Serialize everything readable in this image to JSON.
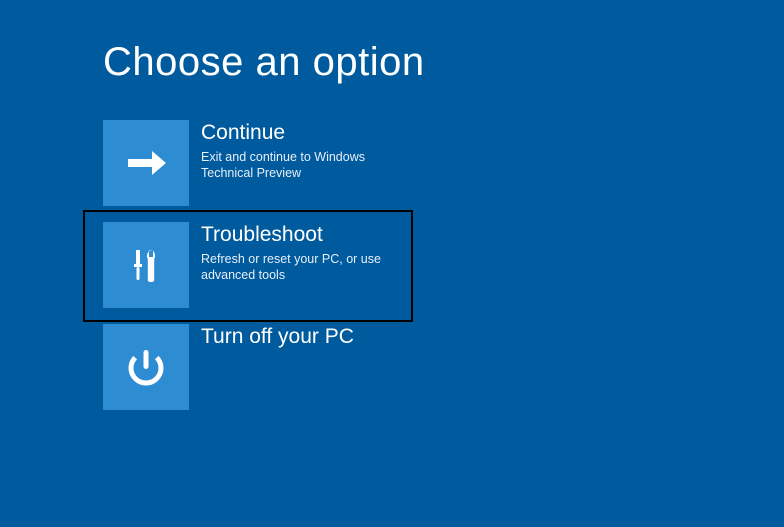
{
  "page": {
    "title": "Choose an option"
  },
  "options": {
    "continue": {
      "title": "Continue",
      "desc": "Exit and continue to Windows Technical Preview"
    },
    "troubleshoot": {
      "title": "Troubleshoot",
      "desc": "Refresh or reset your PC, or use advanced tools"
    },
    "turnoff": {
      "title": "Turn off your PC",
      "desc": ""
    }
  },
  "colors": {
    "background": "#005a9e",
    "tile": "#2e8cd2"
  }
}
